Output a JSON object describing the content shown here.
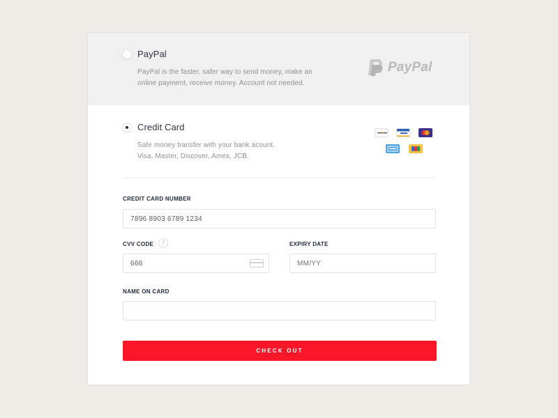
{
  "payment_options": {
    "paypal": {
      "title": "PayPal",
      "description_line1": "PayPal is the faster, safer way to send money, make an",
      "description_line2": "online payment, receive money. Account not needed.",
      "logo_text": "PayPal",
      "selected": false
    },
    "credit_card": {
      "title": "Credit Card",
      "description_line1": "Safe money transfer with your bank acount.",
      "description_line2": "Visa, Master, Discover, Amex, JCB.",
      "selected": true,
      "card_brands": [
        "discover-icon",
        "visa-icon",
        "mastercard-icon",
        "amex-icon",
        "jcb-icon"
      ]
    }
  },
  "form": {
    "card_number": {
      "label": "CREDIT CARD NUMBER",
      "value": "7896 8903 6789 1234"
    },
    "cvv": {
      "label": "CVV CODE",
      "help_glyph": "?",
      "value": "666"
    },
    "expiry": {
      "label": "EXPIRY DATE",
      "placeholder": "MM/YY"
    },
    "name": {
      "label": "NAME ON CARD",
      "value": ""
    },
    "submit_label": "CHECK OUT"
  },
  "colors": {
    "page_background": "#efebe6",
    "paypal_section_background": "#f0f0f0",
    "checkout_button": "#fb1729",
    "text_dark": "#2b3444",
    "text_muted": "#8b8f96"
  }
}
